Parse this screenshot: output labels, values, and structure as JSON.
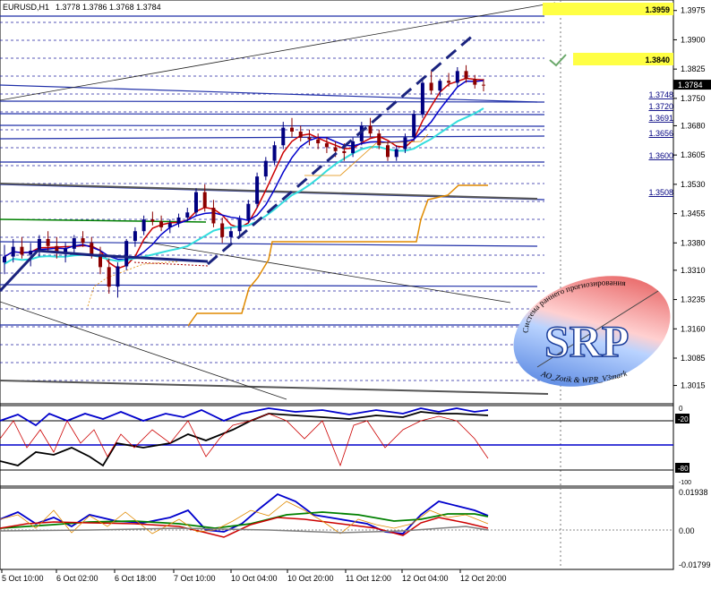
{
  "window": {
    "symbol_title": "EURUSD,H1",
    "ohlc": "1.3778 1.3786 1.3768 1.3784"
  },
  "colors": {
    "background": "#ffffff",
    "bull_candle": "#000080",
    "bear_candle": "#8b0000",
    "level_line": "#1f2fa8",
    "dotted_grid": "#2020a0",
    "ma_blue": "#0000cc",
    "ma_cyan": "#33dddd",
    "ma_red": "#cc0000",
    "stop_orange": "#e08a00",
    "trend_dash": "#1a237e",
    "highlight": "#ffff44",
    "osc_green": "#008000",
    "grey_line": "#808080"
  },
  "chart_data": {
    "type": "candlestick",
    "symbol": "EURUSD",
    "timeframe": "H1",
    "ylim": [
      1.2975,
      1.3995
    ],
    "y_ticks": [
      "1.3975",
      "1.3900",
      "1.3825",
      "1.3750",
      "1.3680",
      "1.3605",
      "1.3530",
      "1.3455",
      "1.3380",
      "1.3310",
      "1.3235",
      "1.3160",
      "1.3085",
      "1.3015"
    ],
    "current_price": "1.3784",
    "highlighted_levels": [
      "1.3959",
      "1.3840"
    ],
    "level_labels": [
      "1.3748",
      "1.3720",
      "1.3691",
      "1.3656",
      "1.3600",
      "1.3508"
    ],
    "x_ticks": [
      "5 Oct 10:00",
      "6 Oct 02:00",
      "6 Oct 18:00",
      "7 Oct 10:00",
      "10 Oct 04:00",
      "10 Oct 20:00",
      "11 Oct 12:00",
      "12 Oct 04:00",
      "12 Oct 20:00"
    ],
    "candles": [
      [
        1.333,
        1.3375,
        1.33,
        1.3345
      ],
      [
        1.3345,
        1.339,
        1.333,
        1.337
      ],
      [
        1.337,
        1.3395,
        1.334,
        1.335
      ],
      [
        1.335,
        1.338,
        1.332,
        1.336
      ],
      [
        1.336,
        1.34,
        1.3345,
        1.339
      ],
      [
        1.339,
        1.341,
        1.336,
        1.3372
      ],
      [
        1.3372,
        1.3395,
        1.334,
        1.3355
      ],
      [
        1.3355,
        1.338,
        1.333,
        1.3365
      ],
      [
        1.3365,
        1.34,
        1.335,
        1.3392
      ],
      [
        1.3392,
        1.341,
        1.337,
        1.338
      ],
      [
        1.338,
        1.3395,
        1.334,
        1.3352
      ],
      [
        1.3352,
        1.337,
        1.33,
        1.3318
      ],
      [
        1.3318,
        1.334,
        1.325,
        1.3268
      ],
      [
        1.3268,
        1.333,
        1.324,
        1.332
      ],
      [
        1.332,
        1.339,
        1.331,
        1.3385
      ],
      [
        1.3385,
        1.342,
        1.337,
        1.341
      ],
      [
        1.341,
        1.345,
        1.34,
        1.344
      ],
      [
        1.344,
        1.346,
        1.3425,
        1.3435
      ],
      [
        1.3435,
        1.345,
        1.341,
        1.342
      ],
      [
        1.342,
        1.344,
        1.3405,
        1.343
      ],
      [
        1.343,
        1.3455,
        1.342,
        1.3445
      ],
      [
        1.3445,
        1.347,
        1.3435,
        1.3458
      ],
      [
        1.3458,
        1.352,
        1.345,
        1.351
      ],
      [
        1.351,
        1.353,
        1.346,
        1.347
      ],
      [
        1.347,
        1.349,
        1.342,
        1.343
      ],
      [
        1.343,
        1.3445,
        1.338,
        1.3395
      ],
      [
        1.3395,
        1.342,
        1.3375,
        1.341
      ],
      [
        1.341,
        1.345,
        1.34,
        1.344
      ],
      [
        1.344,
        1.349,
        1.343,
        1.348
      ],
      [
        1.348,
        1.356,
        1.347,
        1.355
      ],
      [
        1.355,
        1.36,
        1.354,
        1.359
      ],
      [
        1.359,
        1.364,
        1.358,
        1.363
      ],
      [
        1.363,
        1.369,
        1.362,
        1.3675
      ],
      [
        1.3675,
        1.37,
        1.365,
        1.3665
      ],
      [
        1.3665,
        1.368,
        1.364,
        1.365
      ],
      [
        1.365,
        1.367,
        1.363,
        1.3645
      ],
      [
        1.3645,
        1.366,
        1.362,
        1.3635
      ],
      [
        1.3635,
        1.365,
        1.361,
        1.3625
      ],
      [
        1.3625,
        1.364,
        1.36,
        1.3615
      ],
      [
        1.3615,
        1.3635,
        1.359,
        1.361
      ],
      [
        1.361,
        1.365,
        1.36,
        1.364
      ],
      [
        1.364,
        1.369,
        1.363,
        1.368
      ],
      [
        1.368,
        1.37,
        1.365,
        1.366
      ],
      [
        1.366,
        1.367,
        1.362,
        1.363
      ],
      [
        1.363,
        1.364,
        1.359,
        1.36
      ],
      [
        1.36,
        1.363,
        1.359,
        1.362
      ],
      [
        1.362,
        1.366,
        1.361,
        1.365
      ],
      [
        1.365,
        1.372,
        1.364,
        1.371
      ],
      [
        1.371,
        1.38,
        1.37,
        1.379
      ],
      [
        1.379,
        1.382,
        1.376,
        1.377
      ],
      [
        1.377,
        1.38,
        1.3755,
        1.3795
      ],
      [
        1.3795,
        1.3815,
        1.378,
        1.379
      ],
      [
        1.379,
        1.383,
        1.378,
        1.382
      ],
      [
        1.382,
        1.3835,
        1.379,
        1.38
      ],
      [
        1.38,
        1.381,
        1.3775,
        1.3785
      ],
      [
        1.3785,
        1.38,
        1.3768,
        1.3784
      ]
    ],
    "indicator_1": {
      "levels": [
        "-20",
        "-80"
      ],
      "ticks": [
        "0",
        "-20",
        "-80",
        "-100"
      ]
    },
    "indicator_2": {
      "ticks": [
        "0.01938",
        "0.00",
        "-0.01799"
      ]
    }
  },
  "logo": {
    "letters": "SRP",
    "arc_top": "Система раннего прогнозирования",
    "arc_bottom": "AO_Zotik & WPR_V3mark"
  },
  "icons": [
    "checkmark-icon",
    "srp-logo-icon"
  ]
}
